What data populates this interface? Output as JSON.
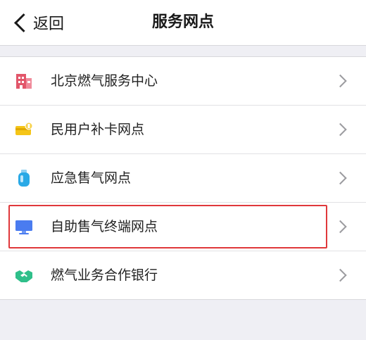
{
  "navbar": {
    "back_label": "返回",
    "title": "服务网点"
  },
  "items": [
    {
      "label": "北京燃气服务中心",
      "icon": "building-icon",
      "color": "#e2566a"
    },
    {
      "label": "民用户补卡网点",
      "icon": "card-icon",
      "color": "#f5c518"
    },
    {
      "label": "应急售气网点",
      "icon": "gas-canister-icon",
      "color": "#2aa9e6"
    },
    {
      "label": "自助售气终端网点",
      "icon": "monitor-icon",
      "color": "#4a7cf0"
    },
    {
      "label": "燃气业务合作银行",
      "icon": "handshake-icon",
      "color": "#2fbf8a"
    }
  ],
  "highlight": {
    "color": "#e0383b",
    "target": "自助售气终端网点"
  }
}
